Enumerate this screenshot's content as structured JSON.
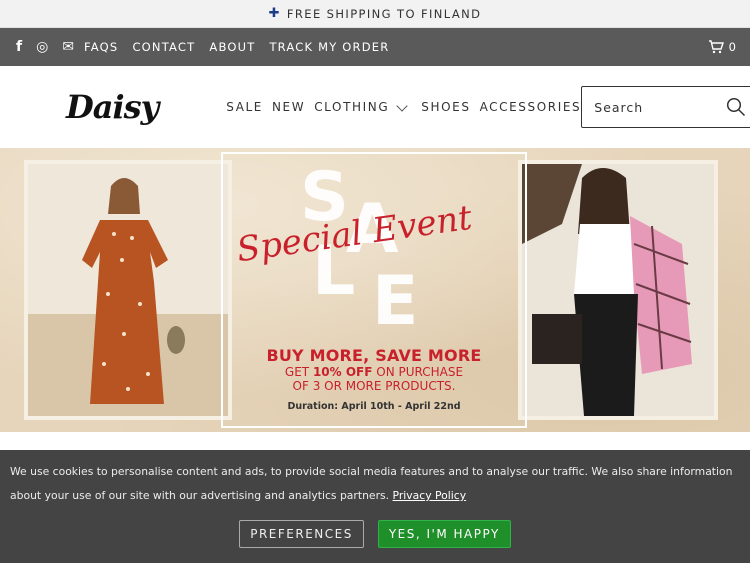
{
  "announcement": {
    "flag_icon": "finland-flag-icon",
    "text": "FREE SHIPPING TO FINLAND"
  },
  "topbar": {
    "social": [
      {
        "name": "facebook-icon",
        "glyph": "f"
      },
      {
        "name": "instagram-icon",
        "glyph": "◎"
      },
      {
        "name": "mail-icon",
        "glyph": "✉"
      }
    ],
    "links": [
      "FAQS",
      "CONTACT",
      "ABOUT",
      "TRACK MY ORDER"
    ],
    "cart_count": "0",
    "cart_icon": "cart-icon"
  },
  "header": {
    "logo": "Daisy",
    "nav": [
      "SALE",
      "NEW",
      "CLOTHING",
      "SHOES",
      "ACCESSORIES"
    ],
    "search_placeholder": "Search",
    "search_icon": "search-icon"
  },
  "hero": {
    "letters": [
      "S",
      "A",
      "L",
      "E"
    ],
    "script_text": "Special Event",
    "headline": "BUY MORE, SAVE MORE",
    "offer_prefix": "GET",
    "offer_bold": "10% OFF",
    "offer_suffix": "ON PURCHASE",
    "offer_line2": "OF 3 OR MORE PRODUCTS.",
    "duration": "Duration: April 10th - April 22nd",
    "colors": {
      "accent_red": "#c8212b",
      "background": "#e6d5bb"
    }
  },
  "cookie": {
    "text": "We use cookies to personalise content and ads, to provide social media features and to analyse our traffic. We also share information about your use of our site with our advertising and analytics partners.",
    "policy_link": "Privacy Policy",
    "preferences_label": "PREFERENCES",
    "accept_label": "YES, I'M HAPPY",
    "colors": {
      "bar": "#444444",
      "accept": "#1f8f2a"
    }
  }
}
